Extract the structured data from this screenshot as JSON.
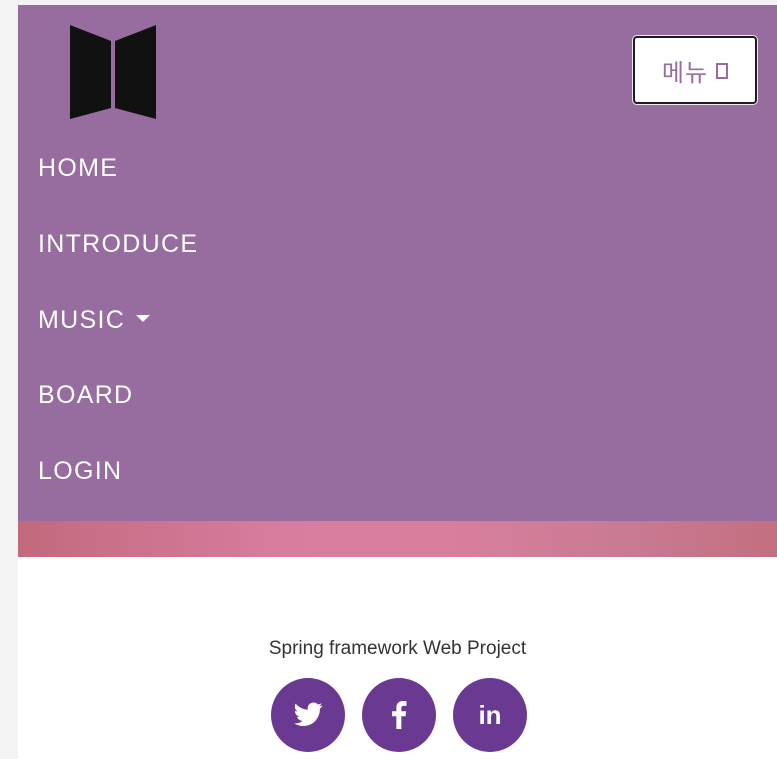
{
  "navbar": {
    "brand_logo": "bts-logo",
    "toggle_label": "메뉴",
    "items": [
      {
        "label": "HOME"
      },
      {
        "label": "INTRODUCE"
      },
      {
        "label": "MUSIC",
        "has_dropdown": true
      },
      {
        "label": "BOARD"
      },
      {
        "label": "LOGIN"
      }
    ],
    "colors": {
      "background": "#976c9f",
      "accent_band": "#d77d9f"
    }
  },
  "footer": {
    "text": "Spring framework Web Project",
    "social_icons": [
      "twitter-icon",
      "facebook-icon",
      "linkedin-icon"
    ],
    "social_color": "#6a3a93"
  }
}
